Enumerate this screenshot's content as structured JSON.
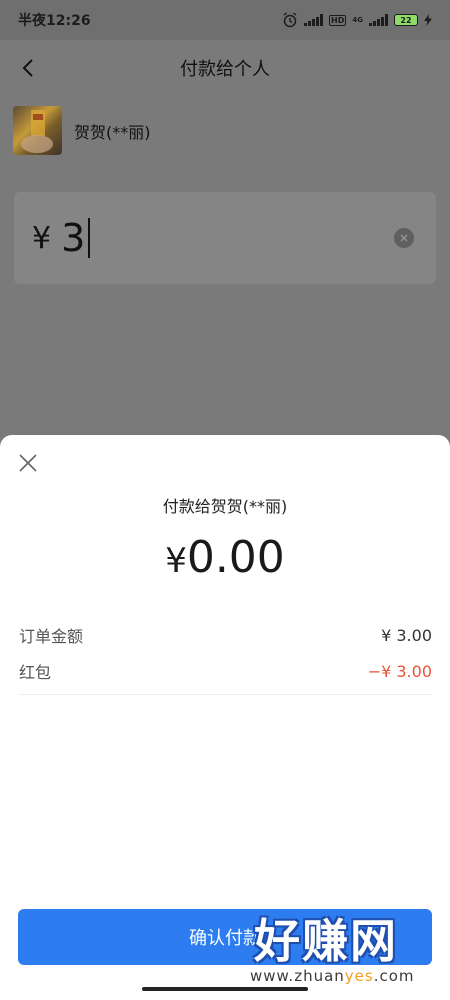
{
  "status_bar": {
    "time": "半夜12:26",
    "hd_badge": "HD",
    "network": "4G",
    "battery": "22"
  },
  "header": {
    "title": "付款给个人"
  },
  "recipient": {
    "name": "贺贺(**丽)"
  },
  "amount_input": {
    "currency_symbol": "¥",
    "value": "3"
  },
  "sheet": {
    "title": "付款给贺贺(**丽)",
    "currency_symbol": "¥",
    "pay_amount": "0.00",
    "rows": [
      {
        "label": "订单金额",
        "value": "¥ 3.00",
        "color": "#333333"
      },
      {
        "label": "红包",
        "value": "−¥ 3.00",
        "color": "#e8553a"
      }
    ],
    "confirm_label": "确认付款"
  },
  "watermark": {
    "brand": "好赚网",
    "url_prefix": "www.zhuan",
    "url_highlight": "yes",
    "url_suffix": ".com"
  },
  "colors": {
    "accent": "#2d7cf0",
    "discount_red": "#e8553a"
  }
}
